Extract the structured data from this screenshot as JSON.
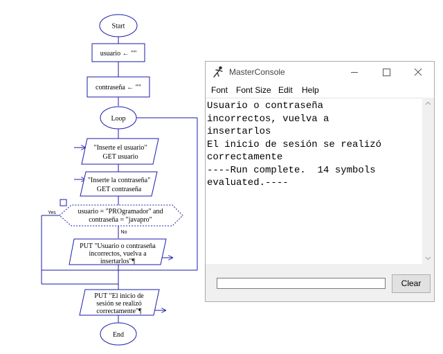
{
  "flowchart": {
    "start": "Start",
    "assign_usuario": "usuario ← \"\"",
    "assign_contrasena": "contraseña ← \"\"",
    "loop": "Loop",
    "input1_line1": "\"Inserte el usuario\"",
    "input1_line2": "GET usuario",
    "input2_line1": "\"Inserte la contraseña\"",
    "input2_line2": "GET contraseña",
    "decision_line1": "usuario = \"PROgramador\" and",
    "decision_line2": "contraseña = \"javapro\"",
    "yes_label": "Yes",
    "no_label": "No",
    "output1_line1": "PUT \"Usuario o contraseña",
    "output1_line2": "incorrectos, vuelva a",
    "output1_line3": "insertarlos\"¶",
    "output2_line1": "PUT \"El inicio de",
    "output2_line2": "sesión se realizó",
    "output2_line3": "correctamente\"¶",
    "end": "End"
  },
  "console": {
    "title": "MasterConsole",
    "menu": [
      "Font",
      "Font Size",
      "Edit",
      "Help"
    ],
    "output_lines": [
      "Usuario o contraseña",
      "incorrectos, vuelva a",
      "insertarlos",
      "El inicio de sesión se realizó",
      "correctamente",
      "----Run complete.  14 symbols",
      "evaluated.----"
    ],
    "input_value": "",
    "clear_label": "Clear"
  },
  "colors": {
    "flow_stroke": "#1a1aaa",
    "flow_fill": "#ffffff"
  }
}
